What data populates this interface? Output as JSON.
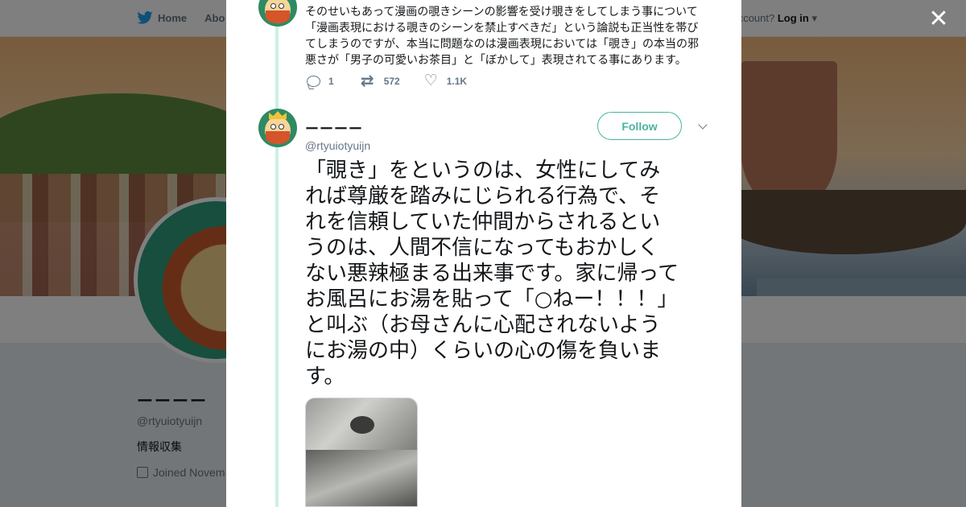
{
  "topbar": {
    "home": "Home",
    "about": "Abo",
    "account_prompt": "ccount?",
    "login": "Log in"
  },
  "profile": {
    "name": "ーーーー",
    "handle": "@rtyuiotyuijn",
    "bio": "情報収集",
    "joined": "Joined Novem"
  },
  "modal": {
    "prev_tweet": {
      "lines": [
        "そのせいもあって漫画の覗きシーンの影響を受け覗きをしてしまう事について",
        "「漫画表現における覗きのシーンを禁止すべきだ」という論説も正当性を帯び",
        "てしまうのですが、本当に問題なのは漫画表現においては「覗き」の本当の邪",
        "悪さが「男子の可愛いお茶目」と「ぼかして」表現されてる事にあります。"
      ],
      "replies": "1",
      "retweets": "572",
      "likes": "1.1K"
    },
    "tweet": {
      "name": "ーーーー",
      "handle": "@rtyuiotyuijn",
      "follow_label": "Follow",
      "lines": [
        "「覗き」をというのは、女性にしてみ",
        "れば尊厳を踏みにじられる行為で、そ",
        "れを信頼していた仲間からされるとい",
        "うのは、人間不信になってもおかしく",
        "ない悪辣極まる出来事です。家に帰って",
        "お風呂にお湯を貼って「○ねー！！！」",
        "と叫ぶ（お母さんに心配されないよう",
        "にお湯の中）くらいの心の傷を負いま",
        "す。"
      ]
    }
  },
  "colors": {
    "accent": "#4ab3a0",
    "thread_line": "#ccf1e4",
    "text": "#14171a",
    "muted": "#657786"
  }
}
